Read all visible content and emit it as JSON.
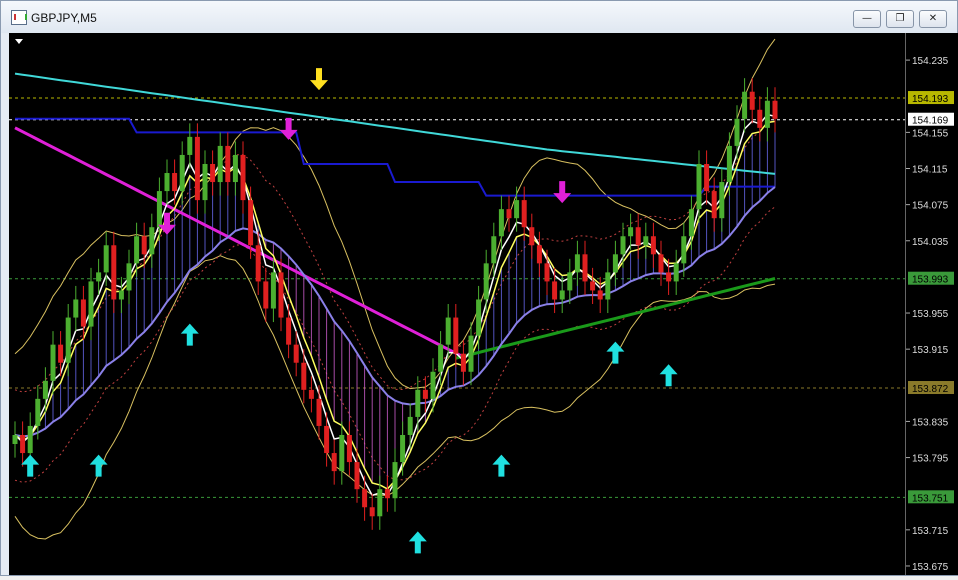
{
  "window": {
    "title": "GBPJPY,M5",
    "minimize_icon": "minimize-icon",
    "restore_icon": "restore-icon",
    "close_icon": "close-icon"
  },
  "chart_data": {
    "type": "candlestick",
    "symbol": "GBPJPY",
    "timeframe": "M5",
    "ylim": [
      153.665,
      154.265
    ],
    "y_ticks": [
      154.235,
      154.155,
      154.115,
      154.075,
      154.035,
      153.955,
      153.915,
      153.835,
      153.795,
      153.715,
      153.675
    ],
    "price_labels": [
      {
        "value": "154.193",
        "color": "#b8b800"
      },
      {
        "value": "154.169",
        "color": "#ffffff"
      },
      {
        "value": "153.993",
        "color": "#3a9a3a"
      },
      {
        "value": "153.872",
        "color": "#8a7a2a"
      },
      {
        "value": "153.751",
        "color": "#3a9a3a"
      }
    ],
    "colors": {
      "background": "#000000",
      "bull_candle": "#4caf30",
      "bear_candle": "#e02020",
      "cyan_ma": "#40d8d8",
      "blue_ma": "#1a1ad0",
      "magenta_ma": "#e020d8",
      "green_ma": "#1a9a1a",
      "bollinger": "#d8c060",
      "fast_ma_white": "#ffffff",
      "fast_ma_yellow": "#ffff60",
      "slow_ma_lavender": "#8a80e8",
      "envelope_dotted": "#c04040",
      "up_arrow": "#20e0e0",
      "down_arrow_magenta": "#e020d8",
      "down_arrow_yellow": "#ffe020"
    },
    "candles_close": [
      153.82,
      153.8,
      153.83,
      153.86,
      153.88,
      153.92,
      153.9,
      153.95,
      153.97,
      153.94,
      153.99,
      154.0,
      154.03,
      153.97,
      153.98,
      154.01,
      154.04,
      154.02,
      154.05,
      154.09,
      154.11,
      154.09,
      154.13,
      154.15,
      154.08,
      154.12,
      154.1,
      154.14,
      154.1,
      154.13,
      154.08,
      154.03,
      153.99,
      153.96,
      154.0,
      153.95,
      153.92,
      153.9,
      153.87,
      153.86,
      153.83,
      153.8,
      153.78,
      153.82,
      153.79,
      153.76,
      153.74,
      153.73,
      153.76,
      153.75,
      153.79,
      153.82,
      153.84,
      153.87,
      153.86,
      153.89,
      153.92,
      153.95,
      153.91,
      153.89,
      153.93,
      153.97,
      154.01,
      154.04,
      154.07,
      154.06,
      154.08,
      154.05,
      154.03,
      154.01,
      153.99,
      153.97,
      153.98,
      154.0,
      154.02,
      153.99,
      153.98,
      153.97,
      154.0,
      154.02,
      154.04,
      154.05,
      154.03,
      154.04,
      154.02,
      154.0,
      153.99,
      154.01,
      154.04,
      154.07,
      154.12,
      154.09,
      154.06,
      154.1,
      154.14,
      154.17,
      154.2,
      154.18,
      154.16,
      154.19,
      154.17
    ],
    "arrows": [
      {
        "type": "up",
        "color": "#20e0e0",
        "candle": 2,
        "price": 153.785
      },
      {
        "type": "up",
        "color": "#20e0e0",
        "candle": 11,
        "price": 153.785
      },
      {
        "type": "down",
        "color": "#e020d8",
        "candle": 20,
        "price": 154.055
      },
      {
        "type": "up",
        "color": "#20e0e0",
        "candle": 23,
        "price": 153.93
      },
      {
        "type": "down",
        "color": "#e020d8",
        "candle": 36,
        "price": 154.16
      },
      {
        "type": "down",
        "color": "#ffe020",
        "candle": 40,
        "price": 154.215
      },
      {
        "type": "up",
        "color": "#20e0e0",
        "candle": 53,
        "price": 153.7
      },
      {
        "type": "up",
        "color": "#20e0e0",
        "candle": 64,
        "price": 153.785
      },
      {
        "type": "down",
        "color": "#e020d8",
        "candle": 72,
        "price": 154.09
      },
      {
        "type": "up",
        "color": "#20e0e0",
        "candle": 79,
        "price": 153.91
      },
      {
        "type": "up",
        "color": "#20e0e0",
        "candle": 86,
        "price": 153.885
      }
    ]
  }
}
